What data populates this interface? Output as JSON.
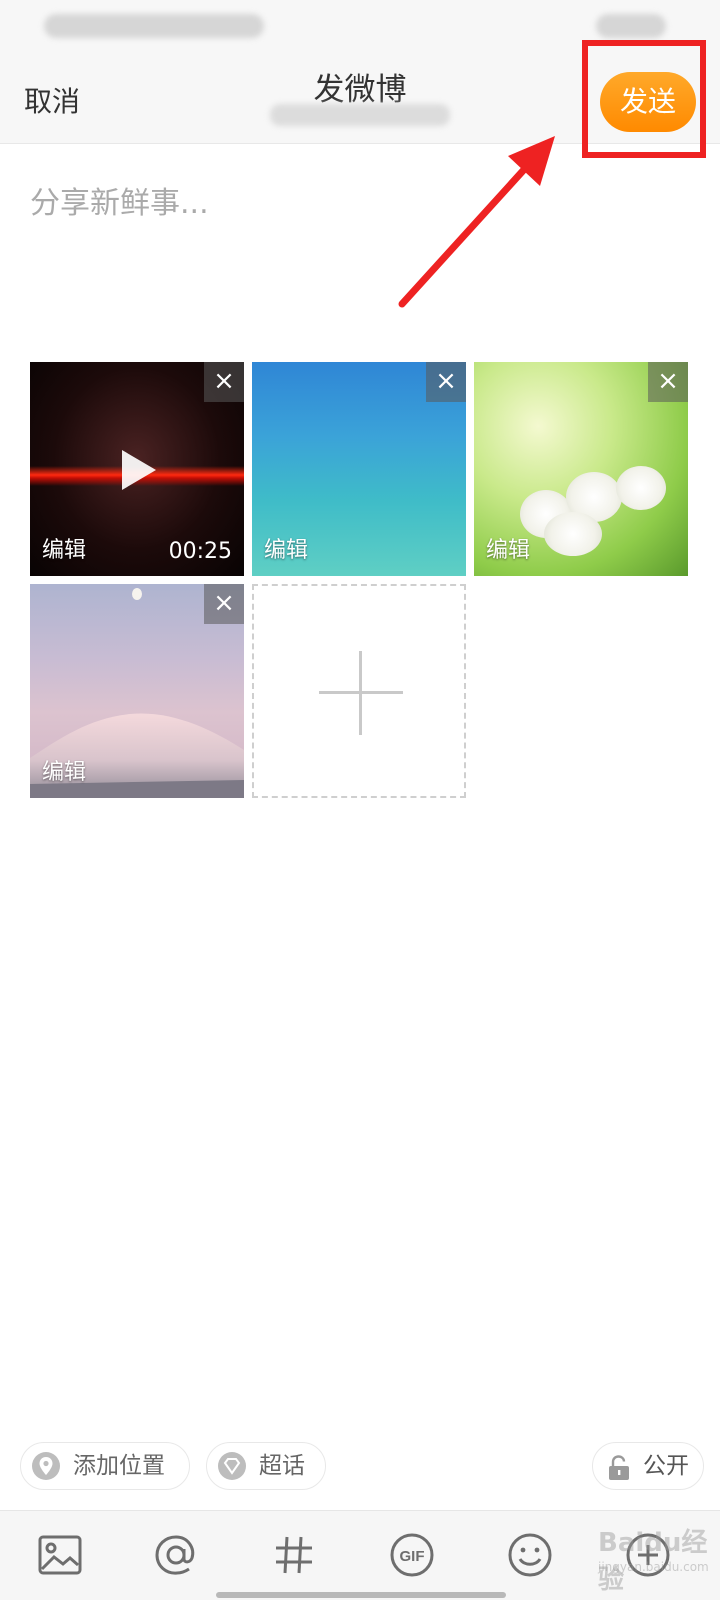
{
  "header": {
    "cancel_label": "取消",
    "title": "发微博",
    "send_label": "发送",
    "send_color": "#ff8c00"
  },
  "compose": {
    "placeholder": "分享新鲜事..."
  },
  "media": [
    {
      "type": "video",
      "edit_label": "编辑",
      "duration": "00:25"
    },
    {
      "type": "image",
      "edit_label": "编辑"
    },
    {
      "type": "image",
      "edit_label": "编辑"
    },
    {
      "type": "image",
      "edit_label": "编辑"
    }
  ],
  "media_close_glyph": "×",
  "pills": {
    "location": "添加位置",
    "super_topic": "超话",
    "visibility": "公开"
  },
  "toolbar": {
    "icons": [
      "image-icon",
      "at-icon",
      "hashtag-icon",
      "gif-icon",
      "emoji-icon",
      "more-icon"
    ],
    "gif_label": "GIF"
  },
  "watermark": {
    "brand": "Baidu经验",
    "sub": "jingyan.baidu.com"
  },
  "annotation_color": "#ee2222"
}
